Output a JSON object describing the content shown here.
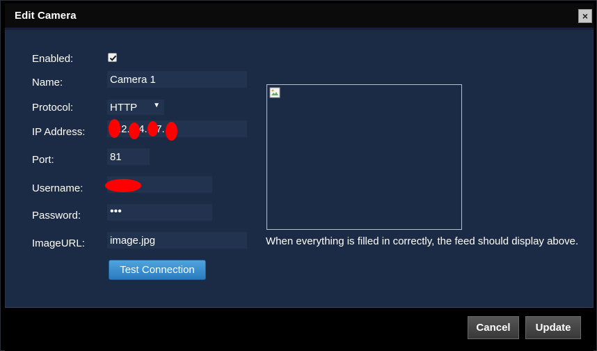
{
  "dialog": {
    "title": "Edit Camera",
    "close_label": "×"
  },
  "form": {
    "enabled_label": "Enabled:",
    "enabled_checked": true,
    "name_label": "Name:",
    "name_value": "Camera 1",
    "protocol_label": "Protocol:",
    "protocol_value": "HTTP",
    "ip_label": "IP Address:",
    "ip_value_visible": ".2.  .4.  .7.  6",
    "port_label": "Port:",
    "port_value": "81",
    "username_label": "Username:",
    "username_value": "",
    "password_label": "Password:",
    "password_value": "•••",
    "imageurl_label": "ImageURL:",
    "imageurl_value": "image.jpg",
    "test_button": "Test Connection"
  },
  "preview": {
    "hint": "When everything is filled in correctly, the feed should display above."
  },
  "footer": {
    "cancel_label": "Cancel",
    "update_label": "Update"
  },
  "colors": {
    "body_bg": "#1b2a45",
    "field_bg": "#223350",
    "accent_button": "#3a8fd0",
    "redaction": "#ff0000"
  }
}
